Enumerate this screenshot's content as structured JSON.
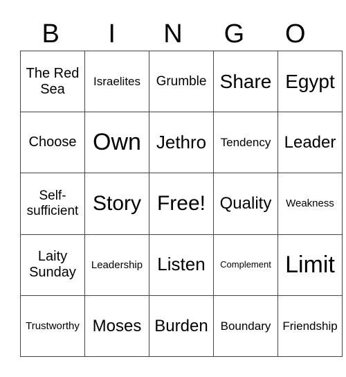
{
  "header": [
    "B",
    "I",
    "N",
    "G",
    "O"
  ],
  "grid": [
    [
      "The Red Sea",
      "Israelites",
      "Grumble",
      "Share",
      "Egypt"
    ],
    [
      "Choose",
      "Own",
      "Jethro",
      "Tendency",
      "Leader"
    ],
    [
      "Self-sufficient",
      "Story",
      "Free!",
      "Quality",
      "Weakness"
    ],
    [
      "Laity Sunday",
      "Leadership",
      "Listen",
      "Complement",
      "Limit"
    ],
    [
      "Trustworthy",
      "Moses",
      "Burden",
      "Boundary",
      "Friendship"
    ]
  ]
}
